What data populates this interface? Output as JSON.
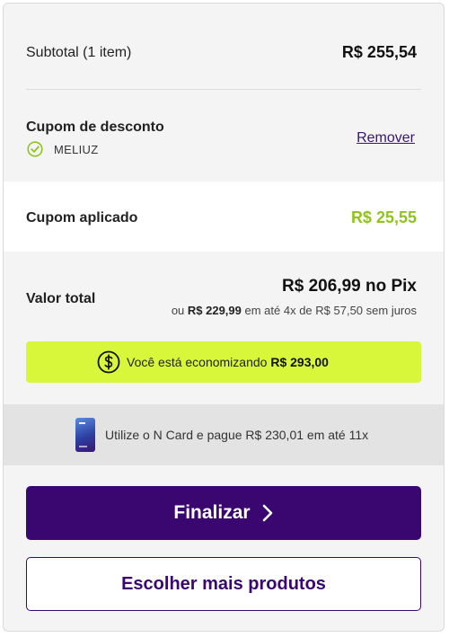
{
  "summary": {
    "subtotal_label": "Subtotal (1 item)",
    "subtotal_value": "R$ 255,54"
  },
  "coupon": {
    "title": "Cupom de desconto",
    "code": "MELIUZ",
    "remove_label": "Remover",
    "check_icon": "check-circle-icon"
  },
  "applied": {
    "label": "Cupom aplicado",
    "value": "R$ 25,55",
    "color": "#8fc31f"
  },
  "total": {
    "label": "Valor total",
    "pix_value": "R$ 206,99 no Pix",
    "install_prefix": "ou ",
    "install_value": "R$ 229,99",
    "install_suffix": " em até 4x de R$ 57,50 sem juros"
  },
  "savings": {
    "prefix": "Você está economizando ",
    "amount": "R$ 293,00",
    "background": "#d9f73a",
    "icon": "dollar-circle-icon"
  },
  "ncard": {
    "text": "Utilize o N Card e pague R$ 230,01 em até 11x",
    "icon": "credit-card-icon"
  },
  "actions": {
    "finalize_label": "Finalizar",
    "more_products_label": "Escolher mais produtos",
    "primary_color": "#3a0670"
  }
}
